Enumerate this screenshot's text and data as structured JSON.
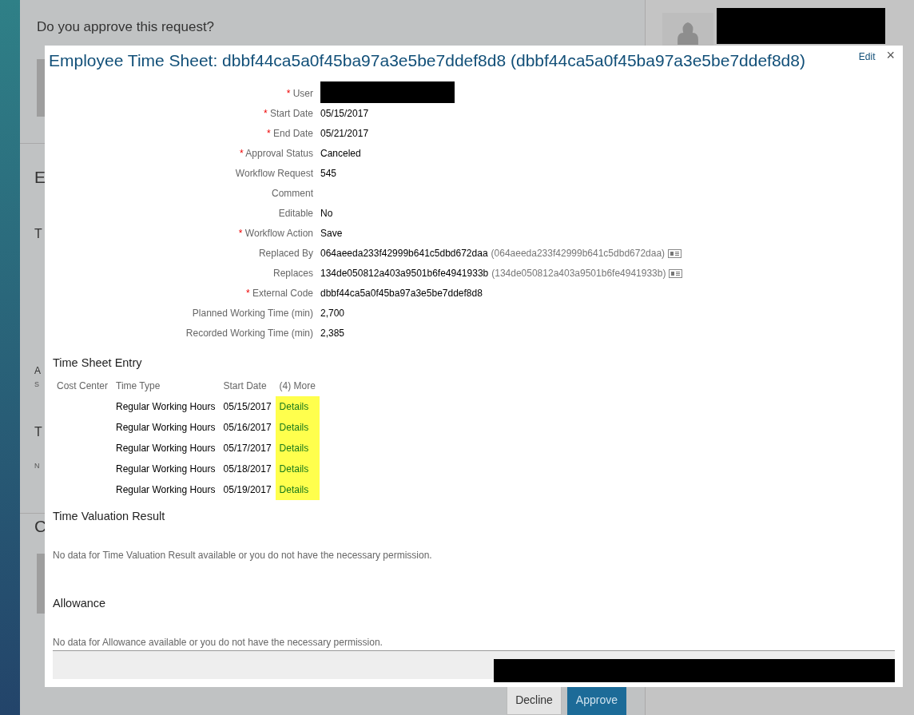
{
  "page": {
    "question": "Do you approve this request?",
    "fragments": [
      {
        "text": "E",
        "kind": "heading"
      },
      {
        "text": "T",
        "kind": "subheading"
      },
      {
        "text": "A",
        "kind": "label"
      },
      {
        "text": "S",
        "kind": "note"
      },
      {
        "text": "T",
        "kind": "subheading"
      },
      {
        "text": "N",
        "kind": "note"
      },
      {
        "text": "C",
        "kind": "heading"
      }
    ],
    "buttons": [
      {
        "label": "Decline",
        "kind": "secondary"
      },
      {
        "label": "Approve",
        "kind": "primary"
      }
    ]
  },
  "modal": {
    "title": "Employee Time Sheet: dbbf44ca5a0f45ba97a3e5be7ddef8d8 (dbbf44ca5a0f45ba97a3e5be7ddef8d8)",
    "edit_link": "Edit",
    "close": "×",
    "fields": [
      {
        "marker": "*",
        "label": "User",
        "kind": "redacted"
      },
      {
        "marker": "*",
        "label": "Start Date",
        "kind": "plain",
        "value": "05/15/2017"
      },
      {
        "marker": "*",
        "label": "End Date",
        "kind": "plain",
        "value": "05/21/2017"
      },
      {
        "marker": "*",
        "label": "Approval Status",
        "kind": "plain",
        "value": "Canceled"
      },
      {
        "label": "Workflow Request",
        "kind": "plain",
        "value": "545"
      },
      {
        "label": "Comment",
        "kind": "empty"
      },
      {
        "label": "Editable",
        "kind": "plain",
        "value": "No"
      },
      {
        "marker": "*",
        "label": "Workflow Action",
        "kind": "plain",
        "value": "Save"
      },
      {
        "label": "Replaced By",
        "kind": "reference",
        "value": "064aeeda233f42999b641c5dbd672daa",
        "ref": "(064aeeda233f42999b641c5dbd672daa)"
      },
      {
        "label": "Replaces",
        "kind": "reference",
        "value": "134de050812a403a9501b6fe4941933b",
        "ref": "(134de050812a403a9501b6fe4941933b)"
      },
      {
        "marker": "*",
        "label": "External Code",
        "kind": "plain",
        "value": "dbbf44ca5a0f45ba97a3e5be7ddef8d8"
      },
      {
        "label": "Planned Working Time (min)",
        "kind": "plain",
        "value": "2,700"
      },
      {
        "label": "Recorded Working Time (min)",
        "kind": "plain",
        "value": "2,385"
      }
    ],
    "entry_section": {
      "title": "Time Sheet Entry",
      "columns": [
        "Cost Center",
        "Time Type",
        "Start Date",
        "(4) More"
      ],
      "rows": [
        {
          "time_type": "Regular Working Hours",
          "start_date": "05/15/2017",
          "link": "Details",
          "highlighted": true
        },
        {
          "time_type": "Regular Working Hours",
          "start_date": "05/16/2017",
          "link": "Details",
          "highlighted": true
        },
        {
          "time_type": "Regular Working Hours",
          "start_date": "05/17/2017",
          "link": "Details",
          "highlighted": true
        },
        {
          "time_type": "Regular Working Hours",
          "start_date": "05/18/2017",
          "link": "Details",
          "highlighted": true
        },
        {
          "time_type": "Regular Working Hours",
          "start_date": "05/19/2017",
          "link": "Details",
          "highlighted": true
        }
      ]
    },
    "sections": [
      {
        "title": "Time Valuation Result",
        "message": "No data for Time Valuation Result available or you do not have the necessary permission."
      },
      {
        "title": "Allowance",
        "message": "No data for Allowance available or you do not have the necessary permission."
      }
    ],
    "footer": {
      "redacted": true
    }
  }
}
